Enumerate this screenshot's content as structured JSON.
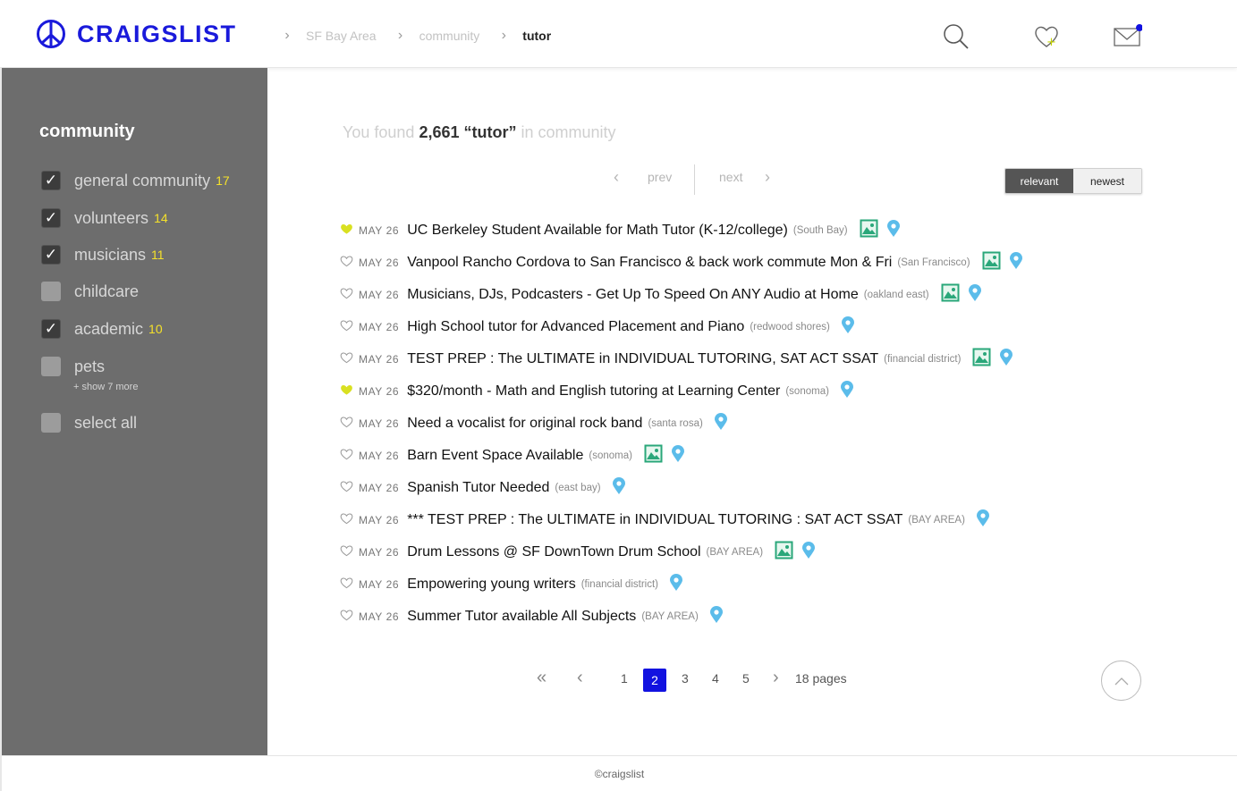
{
  "app": {
    "logo_text": "CRAIGSLIST"
  },
  "breadcrumb": {
    "items": [
      "SF Bay Area",
      "community",
      "tutor"
    ]
  },
  "header_icons": [
    "search-icon",
    "favorites-heart-icon",
    "mail-icon"
  ],
  "sidebar": {
    "title": "community",
    "items": [
      {
        "label": "general community",
        "count": "17",
        "checked": true
      },
      {
        "label": "volunteers",
        "count": "14",
        "checked": true
      },
      {
        "label": "musicians",
        "count": "11",
        "checked": true
      },
      {
        "label": "childcare",
        "count": "",
        "checked": false
      },
      {
        "label": "academic",
        "count": "10",
        "checked": true
      },
      {
        "label": "pets",
        "count": "",
        "checked": false
      }
    ],
    "show_more": "+ show 7 more",
    "select_all": "select all"
  },
  "results": {
    "prefix": "You found",
    "count": "2,661",
    "query": "“tutor”",
    "suffix": "in community"
  },
  "pager_nav": {
    "prev": "prev",
    "next": "next"
  },
  "sort": {
    "relevant": "relevant",
    "newest": "newest",
    "selected": "relevant"
  },
  "listings": [
    {
      "date": "MAY 26",
      "title": "UC Berkeley Student Available for Math Tutor (K-12/college)",
      "location": "(South Bay)",
      "favorited": true,
      "has_image": true,
      "has_map": true
    },
    {
      "date": "MAY 26",
      "title": "Vanpool Rancho Cordova to San Francisco & back work commute Mon & Fri",
      "location": "(San Francisco)",
      "favorited": false,
      "has_image": true,
      "has_map": true
    },
    {
      "date": "MAY 26",
      "title": "Musicians, DJs, Podcasters - Get Up To Speed On ANY Audio at Home",
      "location": "(oakland east)",
      "favorited": false,
      "has_image": true,
      "has_map": true
    },
    {
      "date": "MAY 26",
      "title": "High School tutor for Advanced Placement and Piano",
      "location": "(redwood shores)",
      "favorited": false,
      "has_image": false,
      "has_map": true
    },
    {
      "date": "MAY 26",
      "title": "TEST PREP : The ULTIMATE in INDIVIDUAL TUTORING, SAT ACT SSAT",
      "location": "(financial district)",
      "favorited": false,
      "has_image": true,
      "has_map": true
    },
    {
      "date": "MAY 26",
      "title": "$320/month - Math and English tutoring at Learning Center",
      "location": "(sonoma)",
      "favorited": true,
      "has_image": false,
      "has_map": true
    },
    {
      "date": "MAY 26",
      "title": "Need a vocalist for original rock band",
      "location": "(santa rosa)",
      "favorited": false,
      "has_image": false,
      "has_map": true
    },
    {
      "date": "MAY 26",
      "title": "Barn Event Space Available",
      "location": "(sonoma)",
      "favorited": false,
      "has_image": true,
      "has_map": true
    },
    {
      "date": "MAY 26",
      "title": "Spanish Tutor Needed",
      "location": "(east bay)",
      "favorited": false,
      "has_image": false,
      "has_map": true
    },
    {
      "date": "MAY 26",
      "title": "*** TEST PREP : The ULTIMATE in INDIVIDUAL TUTORING : SAT ACT SSAT",
      "location": "(BAY AREA)",
      "favorited": false,
      "has_image": false,
      "has_map": true
    },
    {
      "date": "MAY 26",
      "title": "Drum Lessons @ SF DownTown Drum School",
      "location": "(BAY AREA)",
      "favorited": false,
      "has_image": true,
      "has_map": true
    },
    {
      "date": "MAY 26",
      "title": "Empowering young writers",
      "location": "(financial district)",
      "favorited": false,
      "has_image": false,
      "has_map": true
    },
    {
      "date": "MAY 26",
      "title": "Summer Tutor available All Subjects",
      "location": "(BAY AREA)",
      "favorited": false,
      "has_image": false,
      "has_map": true
    }
  ],
  "pagination": {
    "pages": [
      "1",
      "2",
      "3",
      "4",
      "5"
    ],
    "current": "2",
    "total": "18 pages"
  },
  "colors": {
    "brand": "#1a1adb",
    "accent_yellow": "#f5e12a",
    "active_page": "#1212e0",
    "pin": "#5bbcea",
    "image_icon": "#2aa77a"
  },
  "footer": {
    "text": "©craigslist"
  }
}
